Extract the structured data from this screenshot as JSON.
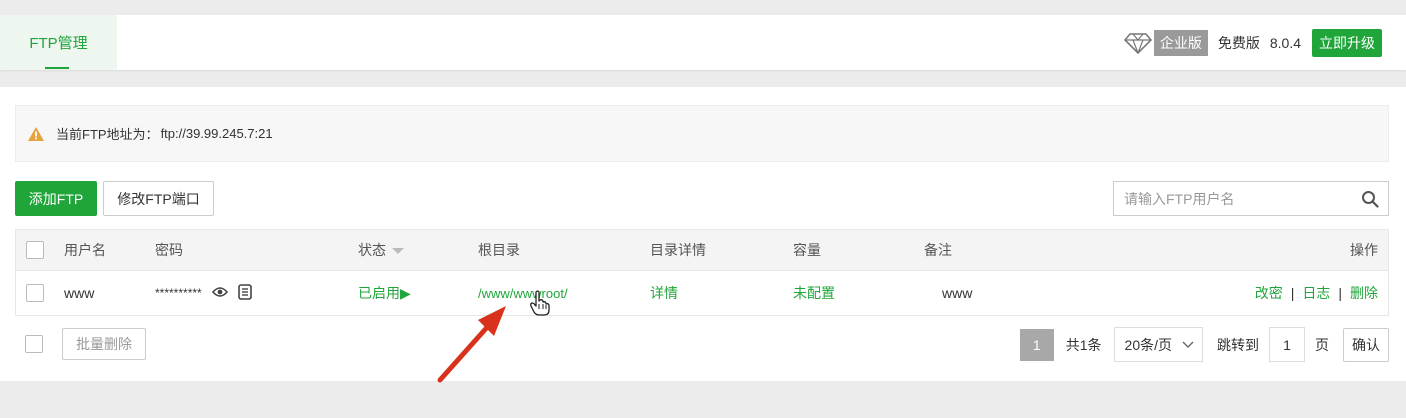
{
  "header": {
    "tab_label": "FTP管理",
    "enterprise_badge": "企业版",
    "free_label": "免费版",
    "version": "8.0.4",
    "upgrade_label": "立即升级",
    "brand_color": "#20a53a"
  },
  "alert": {
    "label": "当前FTP地址为：",
    "address": "ftp://39.99.245.7:21",
    "icon": "warning-icon",
    "icon_color": "#e6a23c"
  },
  "toolbar": {
    "add_label": "添加FTP",
    "port_label": "修改FTP端口",
    "search_placeholder": "请输入FTP用户名"
  },
  "table": {
    "columns": {
      "username": "用户名",
      "password": "密码",
      "status": "状态",
      "root": "根目录",
      "dir_detail": "目录详情",
      "capacity": "容量",
      "remark": "备注",
      "actions": "操作"
    },
    "rows": [
      {
        "username": "www",
        "password": "**********",
        "status": "已启用▶",
        "root": "/www/wwwroot/",
        "dir_detail": "详情",
        "capacity": "未配置",
        "remark": "www",
        "action_edit": "改密",
        "action_log": "日志",
        "action_delete": "删除"
      }
    ]
  },
  "footer": {
    "batch_delete_label": "批量删除",
    "current_page": "1",
    "total_label": "共1条",
    "page_size_label": "20条/页",
    "jump_label": "跳转到",
    "jump_value": "1",
    "page_unit": "页",
    "confirm_label": "确认"
  },
  "annotation": {
    "arrow_color": "#d8321c"
  }
}
